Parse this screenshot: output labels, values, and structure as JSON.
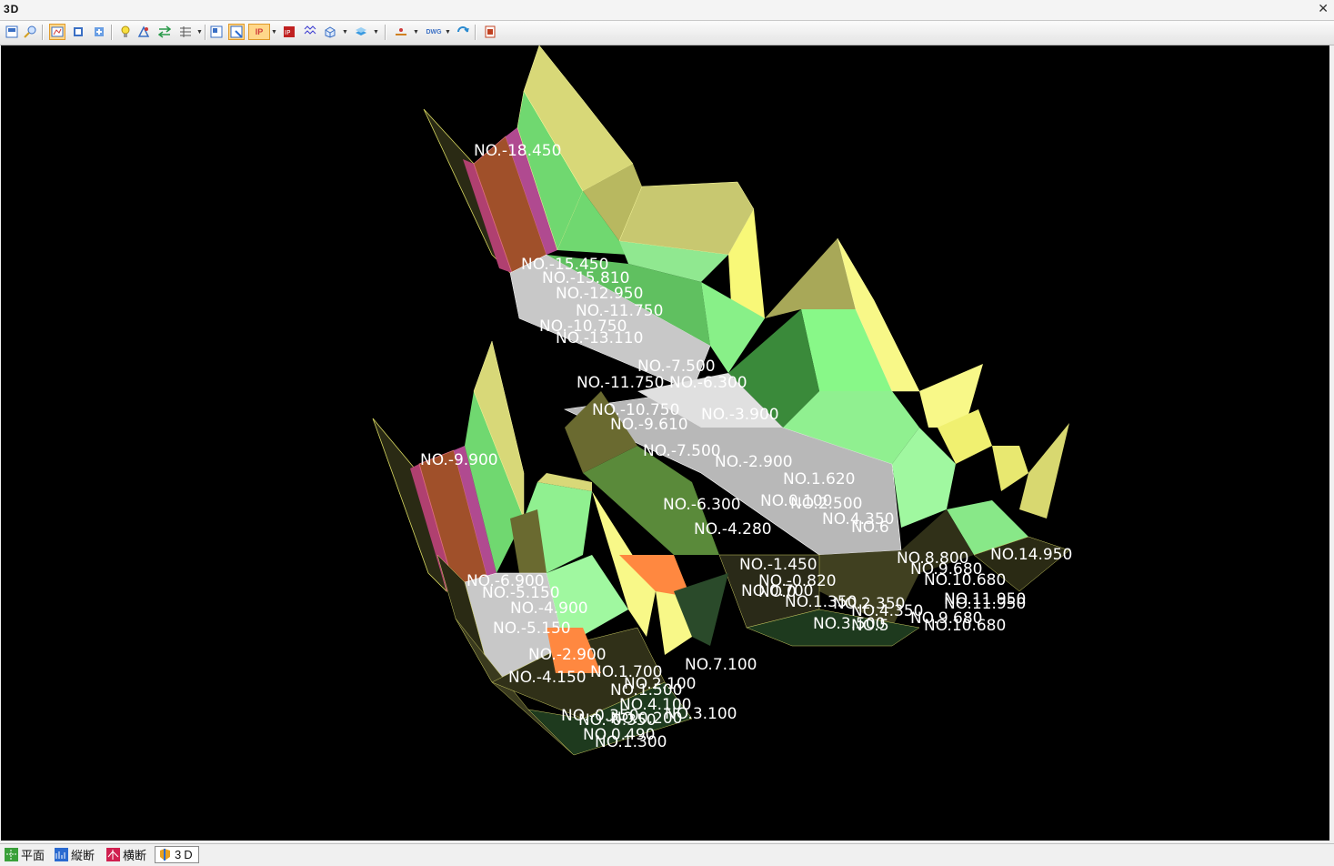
{
  "window": {
    "title": "3D",
    "close_label": "✕"
  },
  "toolbar": {
    "items": [
      {
        "name": "save-view-icon",
        "color": "#3a6fc4"
      },
      {
        "name": "zoom-icon",
        "color": "#d4a020"
      },
      {
        "name": "render-mode-icon",
        "color": "#d03a3a"
      },
      {
        "name": "view-front-icon",
        "color": "#3a6fc4"
      },
      {
        "name": "view-side-icon",
        "color": "#3a6fc4"
      },
      {
        "name": "light-icon",
        "color": "#e8c020"
      },
      {
        "name": "settings-icon",
        "color": "#3a6fc4"
      },
      {
        "name": "swap-icon",
        "color": "#2a9a4a"
      },
      {
        "name": "grid-icon",
        "color": "#555555"
      },
      {
        "name": "frame-icon",
        "color": "#3a6fc4"
      },
      {
        "name": "window-icon",
        "color": "#2a6ad0"
      },
      {
        "name": "ip-label-icon",
        "color": "#d03a3a"
      },
      {
        "name": "ipdata-icon",
        "color": "#c02020"
      },
      {
        "name": "wave-icon",
        "color": "#3a3ad0"
      },
      {
        "name": "box-icon",
        "color": "#3a6fc4"
      },
      {
        "name": "layer-icon",
        "color": "#3a9ae0"
      },
      {
        "name": "measure-icon",
        "color": "#d08020"
      },
      {
        "name": "dwg-icon",
        "color": "#3a6fc4"
      },
      {
        "name": "refresh-icon",
        "color": "#2a8ad0"
      },
      {
        "name": "export-icon",
        "color": "#c04020"
      }
    ],
    "ip_label": "IP",
    "dwg_label": "DWG"
  },
  "scene": {
    "background": "#000000",
    "labels": [
      "NO.-18.450",
      "NO.-15.450",
      "NO.-15.810",
      "NO.-12.950",
      "NO.-11.750",
      "NO.-10.750",
      "NO.-13.110",
      "NO.-7.500",
      "NO.-11.750",
      "NO.-6.300",
      "NO.-10.750",
      "NO.-9.610",
      "NO.-3.900",
      "NO.-7.500",
      "NO.-2.900",
      "NO.-6.300",
      "NO.-4.280",
      "NO.0.100",
      "NO.1.620",
      "NO.2.500",
      "NO.4.350",
      "NO.6",
      "NO.-9.900",
      "NO.-6.900",
      "NO.-5.150",
      "NO.-4.900",
      "NO.-5.150",
      "NO.-2.900",
      "NO.-4.150",
      "NO.1.700",
      "NO.7.100",
      "NO.-1.450",
      "NO.-0.820",
      "NO.0",
      "NO.0.700",
      "NO.1.350",
      "NO.2.350",
      "NO.4.350",
      "NO.3.500",
      "NO.5",
      "NO.8.800",
      "NO.9.680",
      "NO.10.680",
      "NO.11.950",
      "NO.14.950",
      "NO.9.680",
      "NO.11.950",
      "NO.10.680",
      "NO.3.100",
      "NO.4.100",
      "NO.-0.350",
      "NO.-0.350",
      "NO.0.490",
      "NO.1.300",
      "NO.2.100",
      "NO.1.500",
      "NO.0.200"
    ]
  },
  "statusbar": {
    "tabs": [
      {
        "label": "平面",
        "icon": "plan-icon",
        "active": false
      },
      {
        "label": "縦断",
        "icon": "profile-icon",
        "active": false
      },
      {
        "label": "横断",
        "icon": "cross-section-icon",
        "active": false
      },
      {
        "label": "3D",
        "icon": "3d-icon",
        "active": true
      }
    ]
  }
}
